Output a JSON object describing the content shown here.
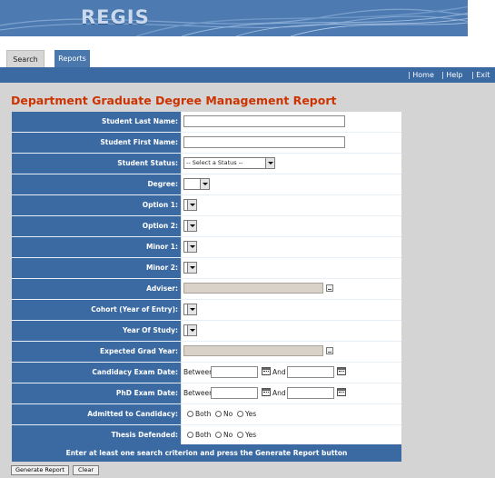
{
  "header": {
    "logo_text": "REGIS"
  },
  "tabs": [
    {
      "label": "Search",
      "active": false
    },
    {
      "label": "Reports",
      "active": true
    }
  ],
  "nav": {
    "home": "| Home",
    "help": "| Help",
    "exit": "| Exit"
  },
  "page_title": "Department Graduate Degree Management Report",
  "form": {
    "last_name_label": "Student Last Name:",
    "first_name_label": "Student First Name:",
    "status_label": "Student Status:",
    "status_value": "-- Select a Status --",
    "degree_label": "Degree:",
    "option1_label": "Option 1:",
    "option2_label": "Option 2:",
    "minor1_label": "Minor 1:",
    "minor2_label": "Minor 2:",
    "adviser_label": "Adviser:",
    "cohort_label": "Cohort (Year of Entry):",
    "year_of_study_label": "Year Of Study:",
    "expected_grad_label": "Expected Grad Year:",
    "candidacy_exam_label": "Candidacy Exam Date:",
    "phd_exam_label": "PhD Exam Date:",
    "admitted_label": "Admitted to Candidacy:",
    "thesis_label": "Thesis Defended:",
    "between_text": "Between",
    "and_text": "And",
    "radio_both": "Both",
    "radio_no": "No",
    "radio_yes": "Yes"
  },
  "footer_hint": "Enter at least one search criterion and press the Generate Report button",
  "buttons": {
    "generate": "Generate Report",
    "clear": "Clear"
  },
  "colors": {
    "accent": "#3b6aa3",
    "title": "#cc3300",
    "background": "#d4d4d4"
  }
}
